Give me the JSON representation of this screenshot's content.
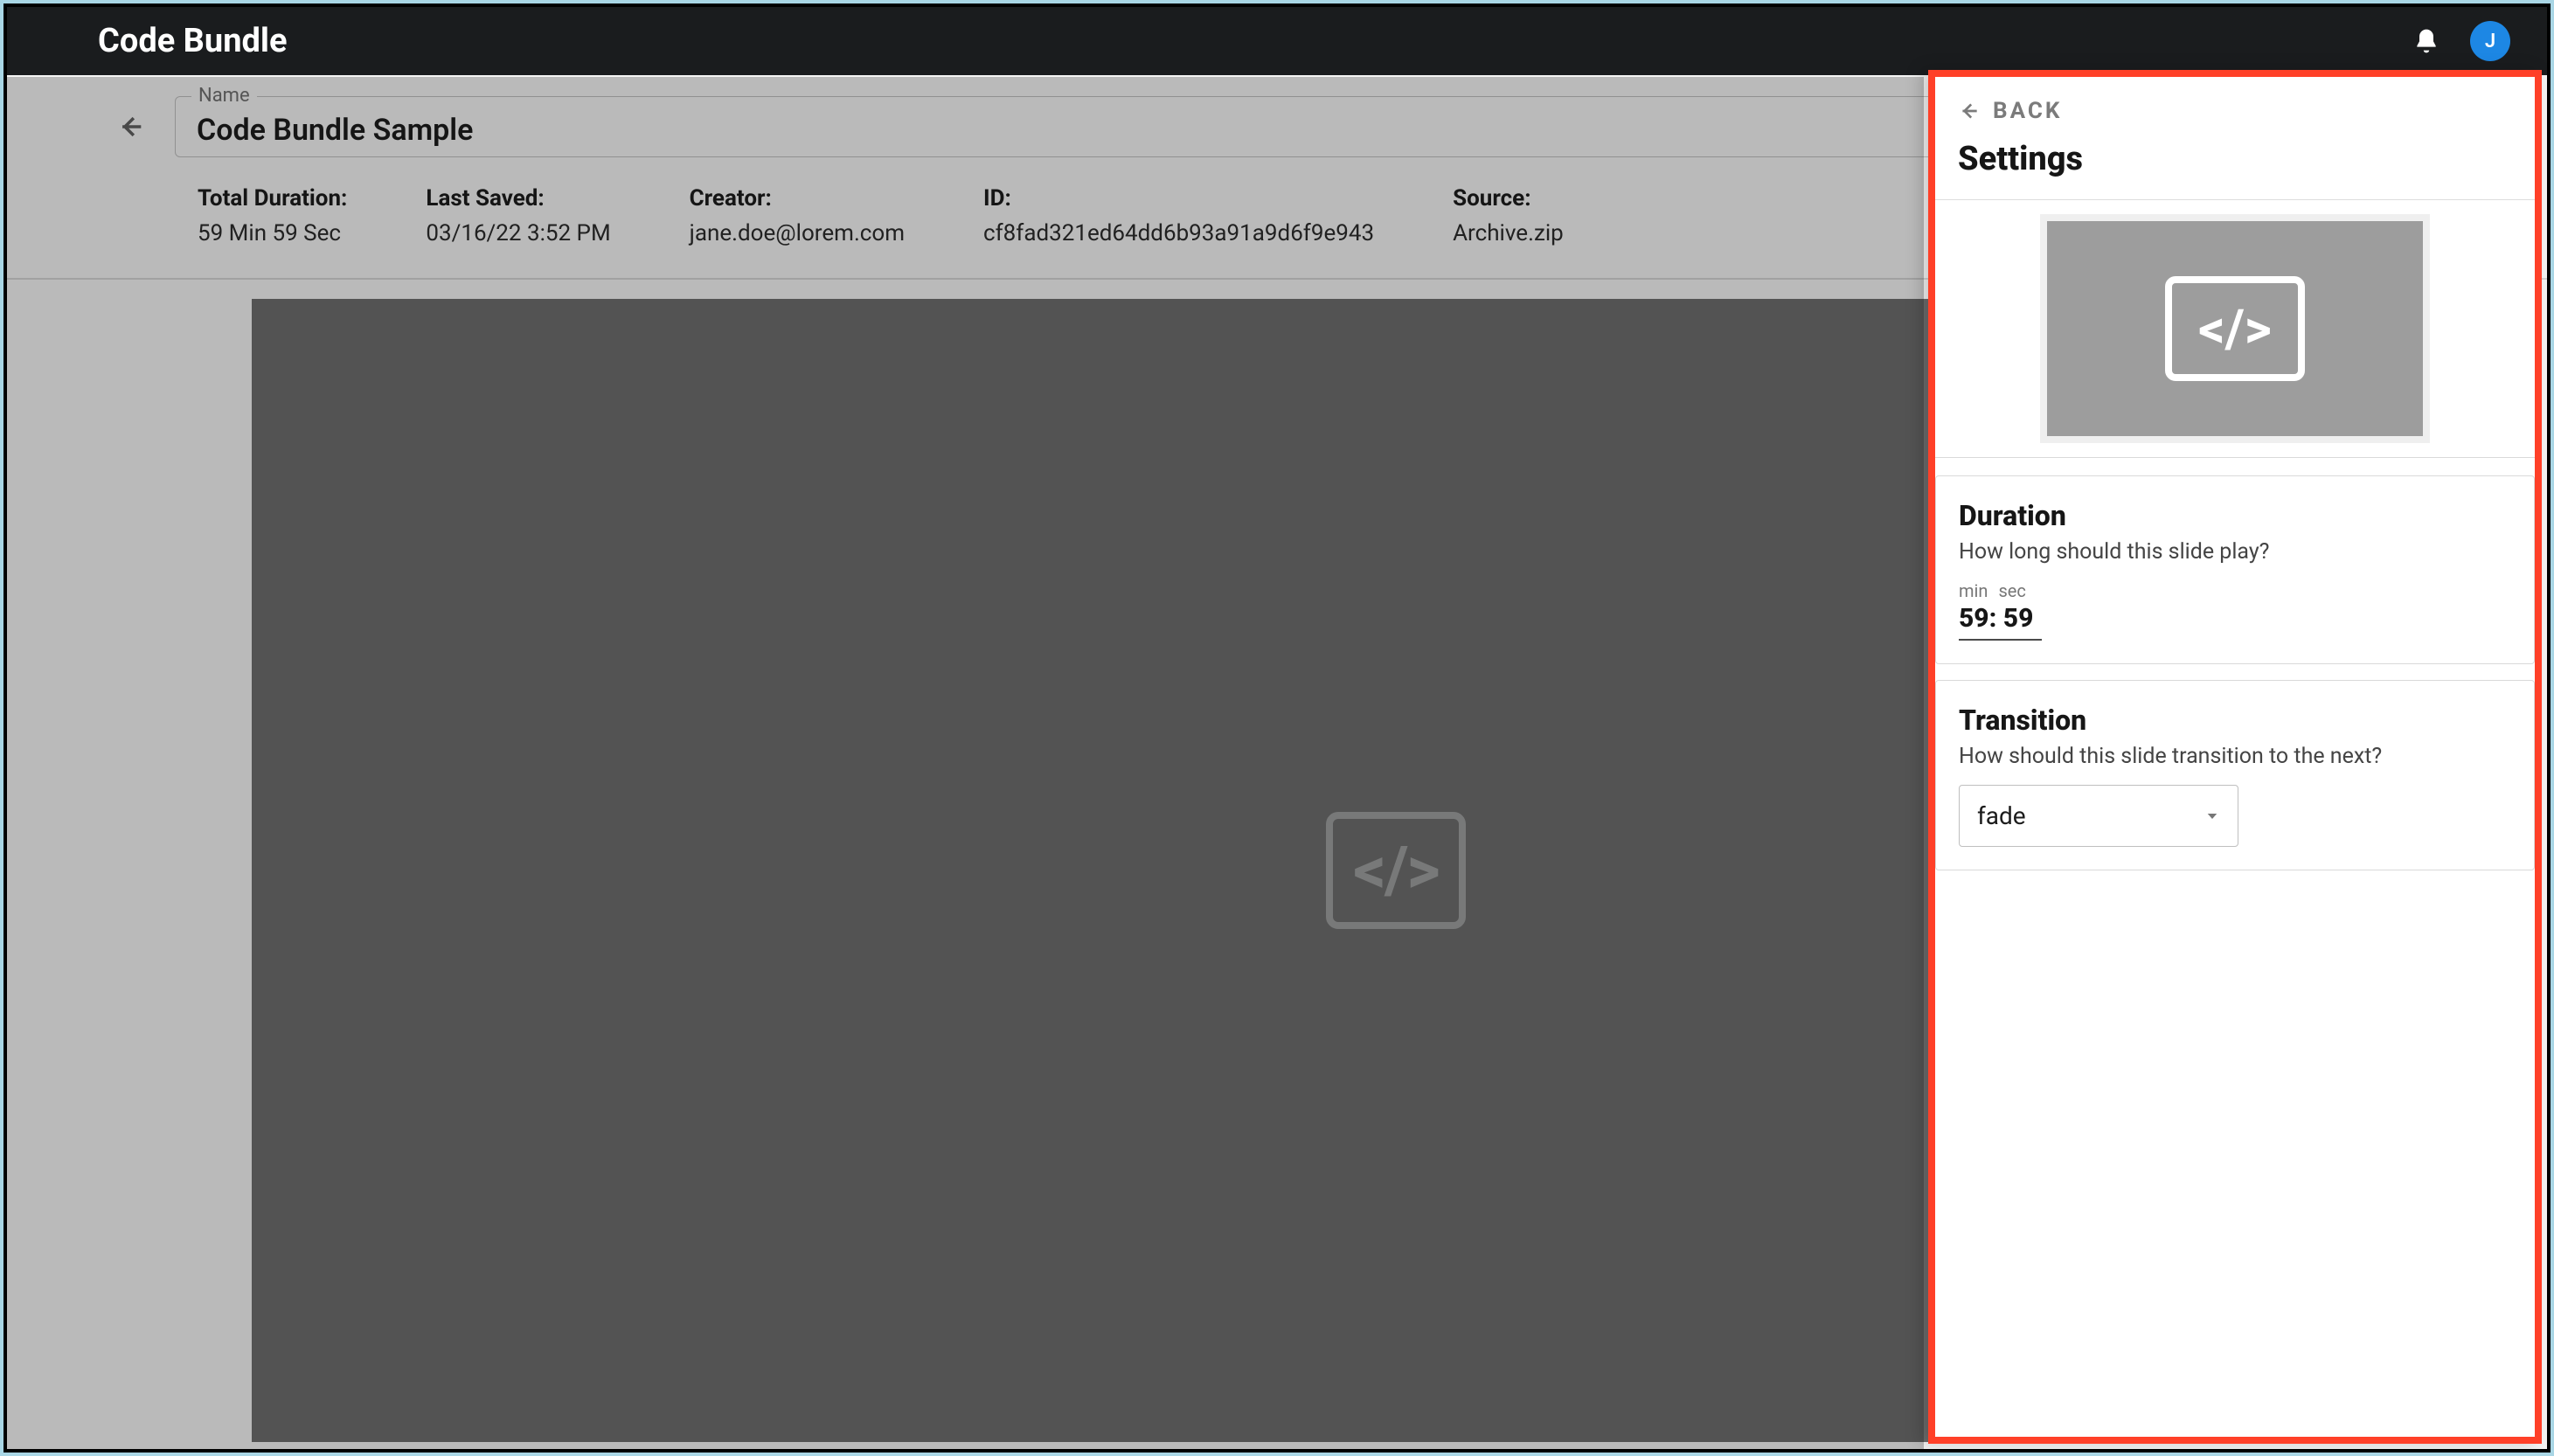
{
  "appbar": {
    "title": "Code Bundle",
    "avatar_initial": "J"
  },
  "name_field": {
    "label": "Name",
    "value": "Code Bundle Sample"
  },
  "meta": {
    "total_duration": {
      "label": "Total Duration:",
      "value": "59 Min 59 Sec"
    },
    "last_saved": {
      "label": "Last Saved:",
      "value": "03/16/22 3:52 PM"
    },
    "creator": {
      "label": "Creator:",
      "value": "jane.doe@lorem.com"
    },
    "id": {
      "label": "ID:",
      "value": "cf8fad321ed64dd6b93a91a9d6f9e943"
    },
    "source": {
      "label": "Source:",
      "value": "Archive.zip"
    }
  },
  "panel": {
    "back_label": "BACK",
    "title": "Settings",
    "duration": {
      "title": "Duration",
      "desc": "How long should this slide play?",
      "min_label": "min",
      "sec_label": "sec",
      "value": "59: 59"
    },
    "transition": {
      "title": "Transition",
      "desc": "How should this slide transition to the next?",
      "selected": "fade"
    }
  }
}
